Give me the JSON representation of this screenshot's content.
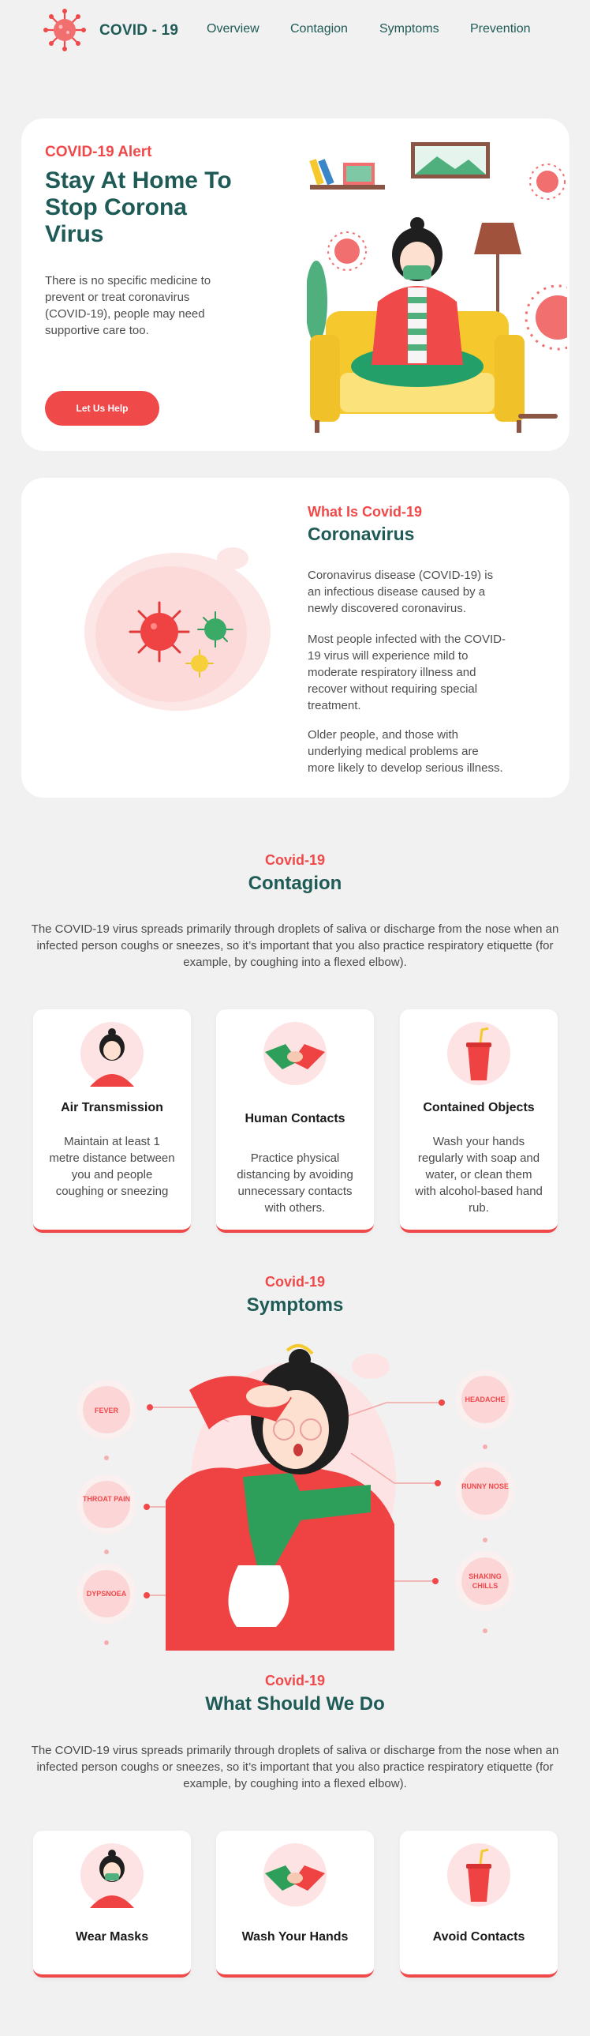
{
  "nav": {
    "brand": "COVID - 19",
    "links": [
      "Overview",
      "Contagion",
      "Symptoms",
      "Prevention"
    ]
  },
  "hero": {
    "eyebrow": "COVID-19 Alert",
    "title_lines": [
      "Stay At Home To",
      "Stop Corona",
      "Virus"
    ],
    "text": "There is no specific medicine to prevent or treat coronavirus (COVID-19), people may need supportive care too.",
    "button": "Let Us Help"
  },
  "about": {
    "eyebrow": "What Is Covid-19",
    "title": "Coronavirus",
    "paragraphs": [
      "Coronavirus disease (COVID-19) is an infectious disease caused by a newly discovered coronavirus.",
      "Most people infected with the COVID-19 virus will experience mild to moderate respiratory illness and recover without requiring special treatment.",
      "Older people, and those with underlying medical problems are more likely to develop serious illness."
    ]
  },
  "contagion": {
    "eyebrow": "Covid-19",
    "title": "Contagion",
    "text": "The COVID-19 virus spreads primarily through droplets of saliva or discharge from the nose when an infected person coughs or sneezes, so it’s important that you also practice respiratory etiquette (for example, by coughing into a flexed elbow).",
    "cards": [
      {
        "title": "Air Transmission",
        "text": "Maintain at least 1 metre distance between you and people coughing or sneezing",
        "icon": "woman-coughing-icon"
      },
      {
        "title": "Human Contacts",
        "text": "Practice physical distancing by avoiding unnecessary contacts with others.",
        "icon": "handshake-icon"
      },
      {
        "title": "Contained Objects",
        "text": "Wash your hands regularly with soap and water, or clean them with alcohol-based hand rub.",
        "icon": "cup-icon"
      }
    ]
  },
  "symptoms": {
    "eyebrow": "Covid-19",
    "title": "Symptoms",
    "left": [
      "FEVER",
      "THROAT PAIN",
      "DYPSNOEA"
    ],
    "right": [
      "HEADACHE",
      "RUNNY NOSE",
      "SHAKING CHILLS"
    ]
  },
  "prevention": {
    "eyebrow": "Covid-19",
    "title": "What Should We Do",
    "text": "The COVID-19 virus spreads primarily through droplets of saliva or discharge from the nose when an infected person coughs or sneezes, so it’s important that you also practice respiratory etiquette (for example, by coughing into a flexed elbow).",
    "cards": [
      {
        "title": "Wear Masks",
        "icon": "mask-woman-icon"
      },
      {
        "title": "Wash Your Hands",
        "icon": "hands-icon"
      },
      {
        "title": "Avoid Contacts",
        "icon": "cup-icon"
      }
    ]
  },
  "colors": {
    "accent": "#f0494a",
    "brand": "#1e5a56",
    "background": "#f1f1f1"
  }
}
